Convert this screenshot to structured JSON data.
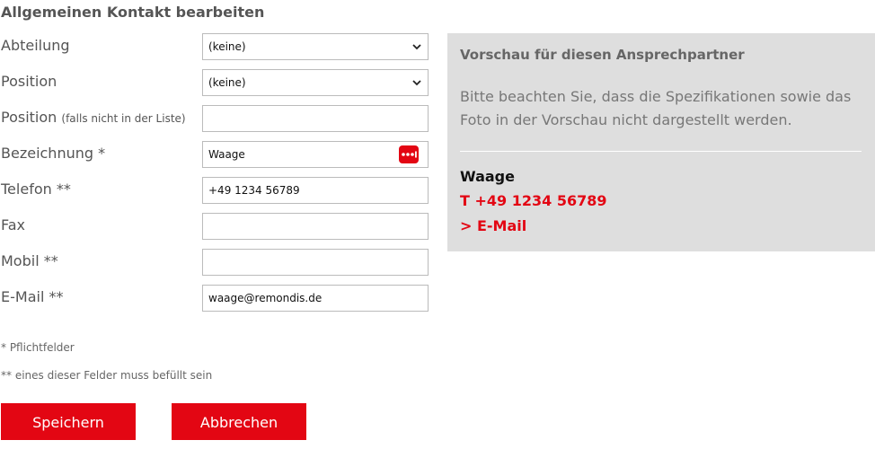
{
  "form": {
    "title": "Allgemeinen Kontakt bearbeiten",
    "fields": {
      "abteilung": {
        "label": "Abteilung",
        "value": "(keine)"
      },
      "position": {
        "label": "Position",
        "value": "(keine)"
      },
      "position_free": {
        "label": "Position",
        "hint": "(falls nicht in der Liste)",
        "value": ""
      },
      "bezeichnung": {
        "label": "Bezeichnung *",
        "value": "Waage"
      },
      "telefon": {
        "label": "Telefon **",
        "value": "+49 1234 56789"
      },
      "fax": {
        "label": "Fax",
        "value": ""
      },
      "mobil": {
        "label": "Mobil **",
        "value": ""
      },
      "email": {
        "label": "E-Mail **",
        "value": "waage@remondis.de"
      }
    },
    "required_note": "* Pflichtfelder",
    "either_note": "** eines dieser Felder muss befüllt sein",
    "save_label": "Speichern",
    "cancel_label": "Abbrechen"
  },
  "preview": {
    "title": "Vorschau für diesen Ansprechpartner",
    "description": "Bitte beachten Sie, dass die Spezifikationen sowie das Foto in der Vorschau nicht dargestellt werden.",
    "name": "Waage",
    "phone": "T +49 1234 56789",
    "email_link": "> E-Mail"
  },
  "colors": {
    "accent": "#e30613",
    "preview_bg": "#dedede",
    "text": "#555555"
  },
  "icons": {
    "select_arrow": "chevron-down-icon",
    "password_manager": "ellipsis-icon"
  }
}
